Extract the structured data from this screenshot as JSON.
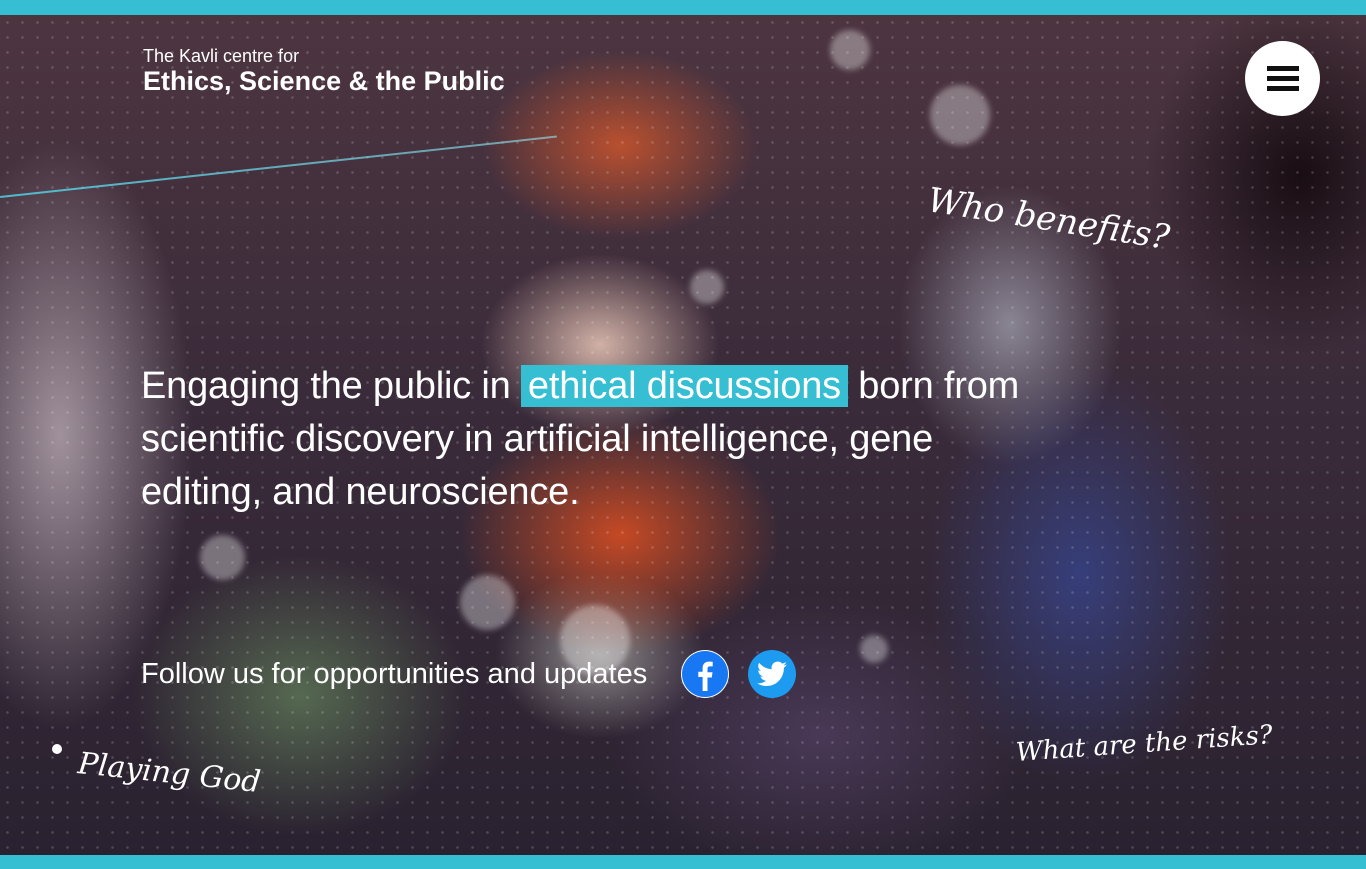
{
  "colors": {
    "accent": "#36bed3",
    "text": "#ffffff",
    "twitter": "#1d9bf0",
    "facebook": "#1877f2"
  },
  "header": {
    "org_small": "The Kavli centre for",
    "org_large": "Ethics, Science & the Public",
    "menu_icon": "hamburger-menu-icon"
  },
  "hero": {
    "headline_before": "Engaging the public in ",
    "headline_highlight": "ethical discussions",
    "headline_after": " born from scientific discovery in artificial intelligence, gene editing, and neuroscience."
  },
  "social": {
    "follow_label": "Follow us for opportunities and updates",
    "icons": [
      "facebook-icon",
      "twitter-icon"
    ]
  },
  "annotations": {
    "who_benefits": "Who benefits?",
    "what_risks": "What are the risks?",
    "playing_god": "Playing God"
  }
}
